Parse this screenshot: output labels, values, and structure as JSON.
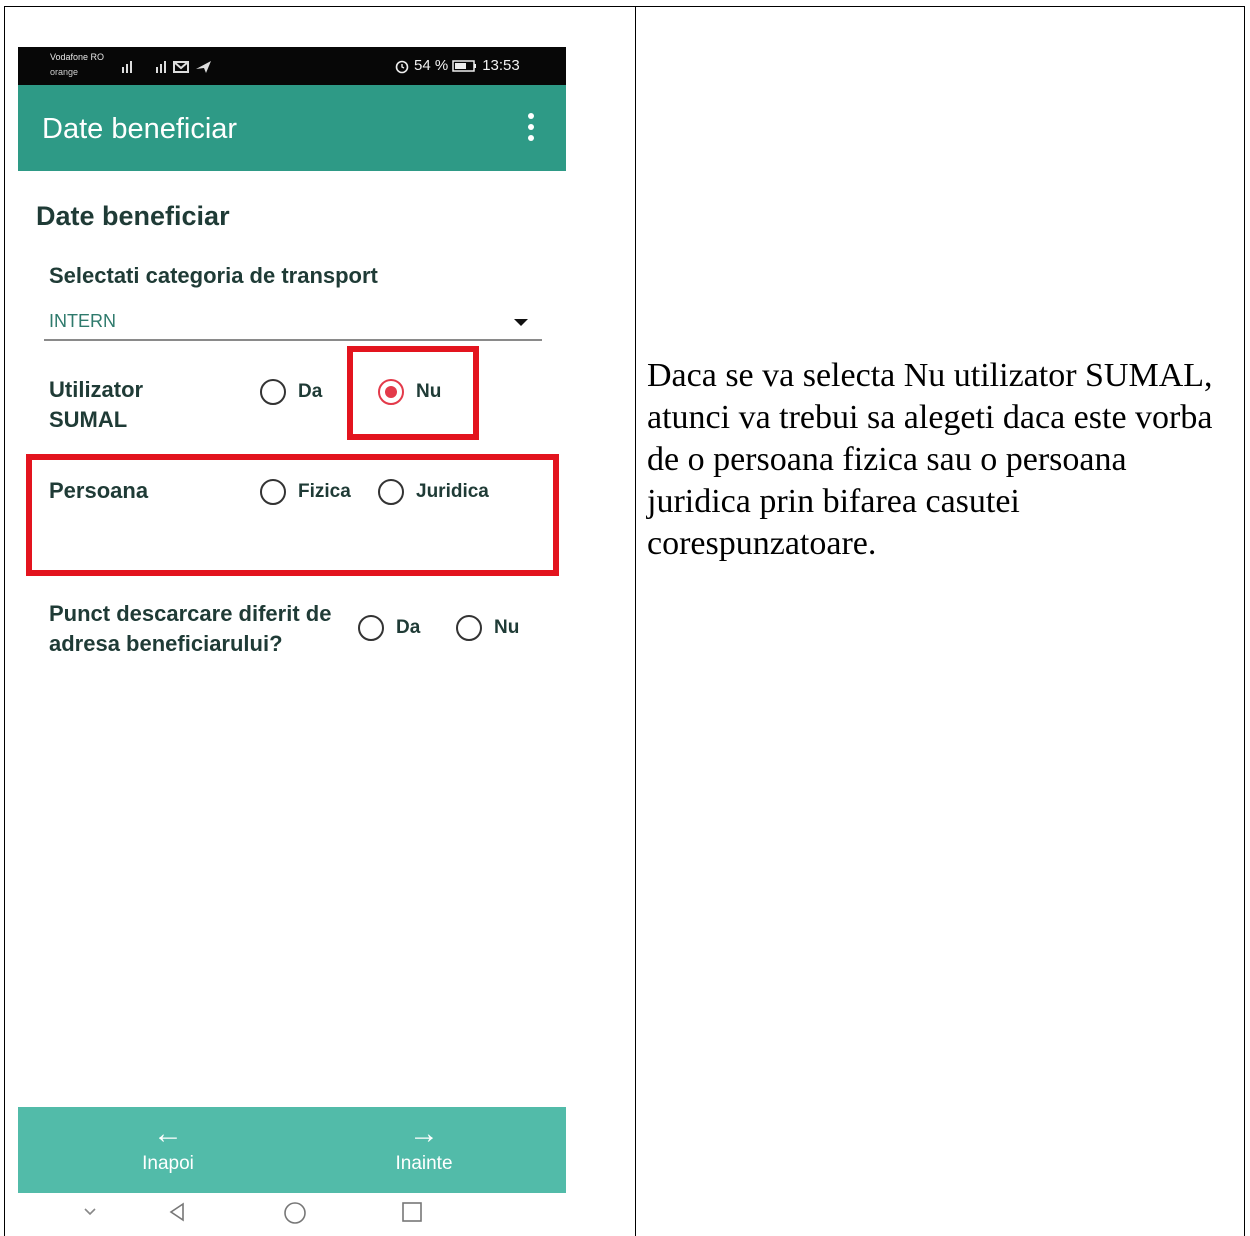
{
  "status_bar": {
    "carrier_line1": "Vodafone RO",
    "carrier_line2": "orange",
    "battery_text": "54 %",
    "time": "13:53"
  },
  "app_bar": {
    "title": "Date beneficiar",
    "menu_icon": "kebab-menu-icon"
  },
  "form": {
    "section_title": "Date beneficiar",
    "category_label": "Selectati categoria de transport",
    "category_value": "INTERN",
    "sumal_label": "Utilizator SUMAL",
    "sumal_options": [
      "Da",
      "Nu"
    ],
    "sumal_selected": "Nu",
    "person_label": "Persoana",
    "person_options": [
      "Fizica",
      "Juridica"
    ],
    "unload_label": "Punct descarcare diferit de adresa beneficiarului?",
    "unload_options": [
      "Da",
      "Nu"
    ]
  },
  "bottom_nav": {
    "back_label": "Inapoi",
    "next_label": "Inainte"
  },
  "highlight_color": "#e3141e",
  "accent_color": "#2e9a86",
  "right_text": "Daca se va selecta Nu utilizator SUMAL, atunci va trebui sa alegeti daca este vorba de o persoana fizica sau o persoana juridica prin bifarea casutei corespunzatoare."
}
